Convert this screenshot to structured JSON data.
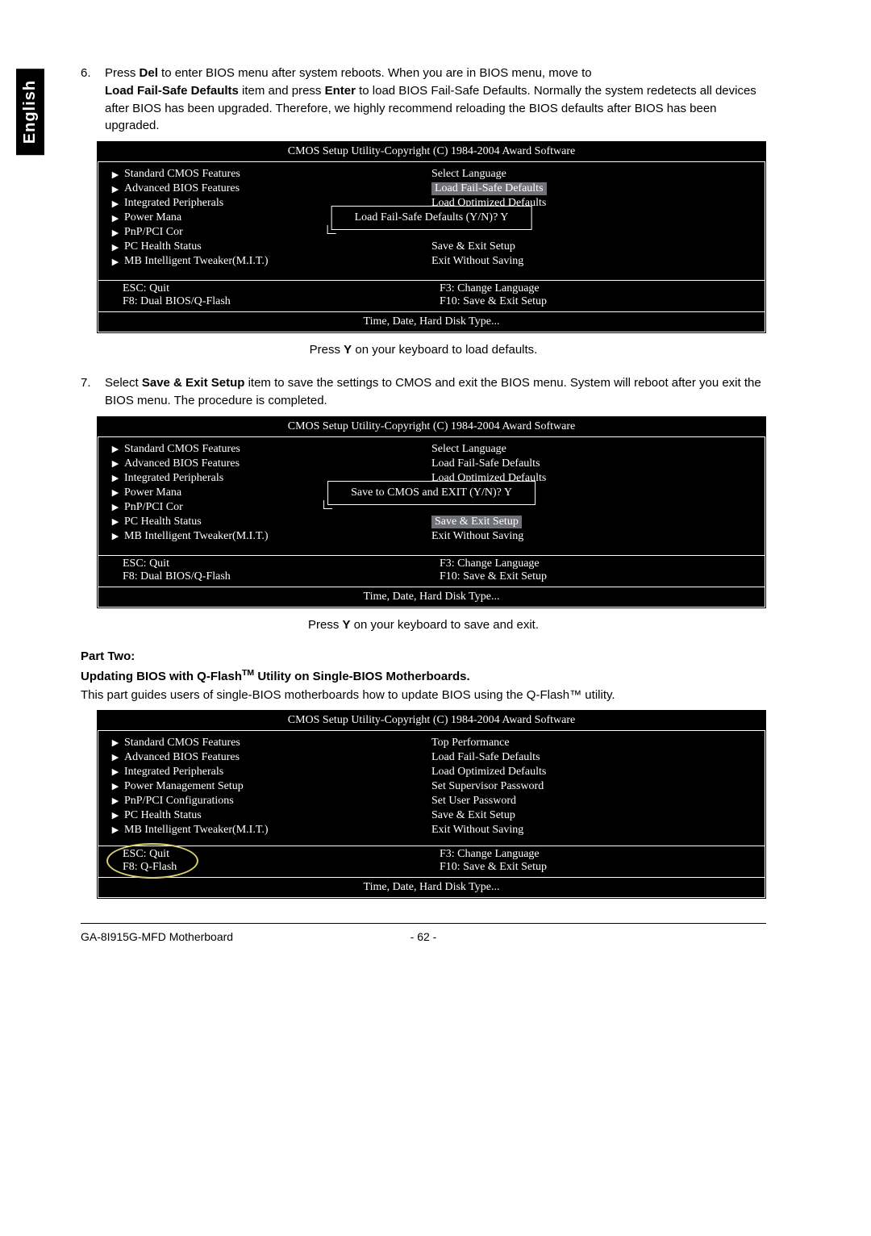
{
  "lang_tab": "English",
  "step6": {
    "num": "6.",
    "line1a": "Press ",
    "line1b": "Del",
    "line1c": " to enter BIOS menu after system reboots. When you are in BIOS menu, move to",
    "line2a": "Load Fail-Safe Defaults",
    "line2b": " item and press ",
    "line2c": "Enter",
    "line2d": " to load BIOS Fail-Safe Defaults. Normally the system redetects all devices after BIOS has been upgraded. Therefore, we highly recommend reloading the BIOS defaults after BIOS has been upgraded."
  },
  "caption6a": "Press ",
  "caption6b": "Y",
  "caption6c": " on your keyboard to load defaults.",
  "step7": {
    "num": "7.",
    "line1a": "Select ",
    "line1b": "Save & Exit Setup",
    "line1c": " item to save the settings to CMOS and exit the BIOS menu. System will reboot after you exit the BIOS menu. The procedure is completed."
  },
  "caption7a": "Press ",
  "caption7b": "Y",
  "caption7c": " on your keyboard to save and exit.",
  "part_two_label": "Part Two:",
  "subhead_a": "Updating BIOS with Q-Flash",
  "subhead_tm": "TM",
  "subhead_b": " Utility on Single-BIOS Motherboards.",
  "intro": "This part guides users of single-BIOS motherboards how to update BIOS using the Q-Flash™ utility.",
  "bios_common": {
    "title": "CMOS Setup Utility-Copyright (C) 1984-2004 Award Software",
    "left_items": [
      "Standard CMOS Features",
      "Advanced BIOS Features",
      "Integrated Peripherals",
      "Power Management Setup",
      "PnP/PCI Configurations",
      "PC Health Status",
      "MB Intelligent Tweaker(M.I.T.)"
    ],
    "footer2": "Time, Date, Hard Disk Type..."
  },
  "bios1": {
    "right_items": [
      "Select Language",
      "Load Fail-Safe Defaults",
      "Load Optimized Defaults",
      "",
      "",
      "Save & Exit Setup",
      "Exit Without Saving"
    ],
    "highlight_right_index": 1,
    "left3_trunc": "Power Mana",
    "left4_trunc": "PnP/PCI Cor",
    "dialog": "Load Fail-Safe Defaults (Y/N)? Y",
    "foot_l1": "ESC: Quit",
    "foot_l2": "F8: Dual BIOS/Q-Flash",
    "foot_r1": "F3: Change Language",
    "foot_r2": "F10: Save & Exit Setup"
  },
  "bios2": {
    "right_items": [
      "Select Language",
      "Load Fail-Safe Defaults",
      "Load Optimized Defaults",
      "",
      "",
      "Save & Exit Setup",
      "Exit Without Saving"
    ],
    "highlight_right_index": 5,
    "left3_trunc": "Power Mana",
    "left4_trunc": "PnP/PCI Cor",
    "dialog": "Save to CMOS and EXIT (Y/N)? Y",
    "foot_l1": "ESC: Quit",
    "foot_l2": "F8: Dual BIOS/Q-Flash",
    "foot_r1": "F3: Change Language",
    "foot_r2": "F10: Save & Exit Setup"
  },
  "bios3": {
    "right_items": [
      "Top Performance",
      "Load Fail-Safe Defaults",
      "Load Optimized Defaults",
      "Set Supervisor Password",
      "Set User Password",
      "Save & Exit Setup",
      "Exit Without Saving"
    ],
    "foot_l1": "ESC: Quit",
    "foot_l2": "F8: Q-Flash",
    "foot_r1": "F3: Change Language",
    "foot_r2": "F10: Save & Exit Setup"
  },
  "footer": {
    "left": "GA-8I915G-MFD Motherboard",
    "center": "- 62 -"
  }
}
